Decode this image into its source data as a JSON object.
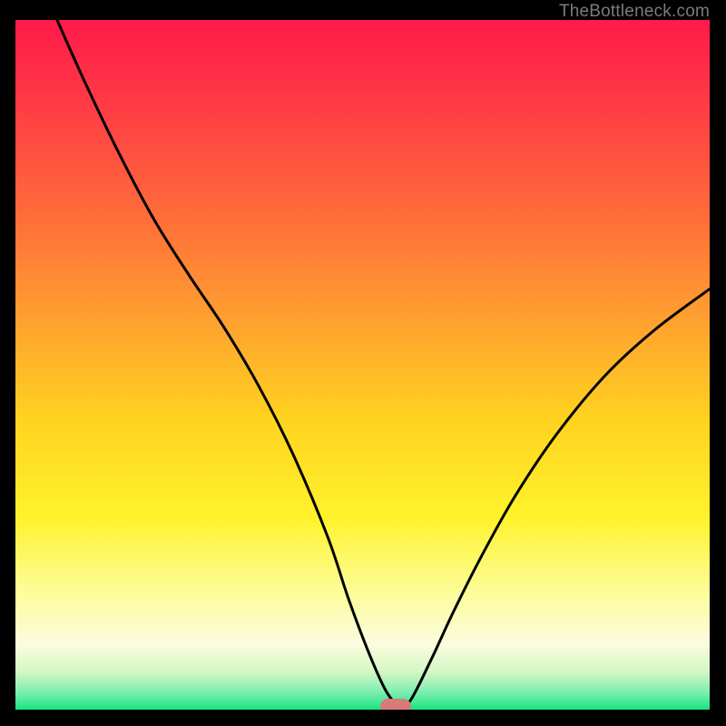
{
  "watermark": "TheBottleneck.com",
  "chart_data": {
    "type": "line",
    "title": "",
    "xlabel": "",
    "ylabel": "",
    "xlim": [
      0,
      100
    ],
    "ylim": [
      0,
      100
    ],
    "grid": false,
    "legend": false,
    "gradient_stops": [
      {
        "pos": 0.0,
        "color": "#ff1a4a"
      },
      {
        "pos": 0.12,
        "color": "#ff3a45"
      },
      {
        "pos": 0.28,
        "color": "#ff6b3a"
      },
      {
        "pos": 0.44,
        "color": "#ffa22f"
      },
      {
        "pos": 0.58,
        "color": "#ffd31f"
      },
      {
        "pos": 0.72,
        "color": "#fff22a"
      },
      {
        "pos": 0.83,
        "color": "#fdfd9a"
      },
      {
        "pos": 0.905,
        "color": "#fbfce0"
      },
      {
        "pos": 0.945,
        "color": "#d4f7c4"
      },
      {
        "pos": 0.975,
        "color": "#7ceeb0"
      },
      {
        "pos": 1.0,
        "color": "#18e47f"
      }
    ],
    "series": [
      {
        "name": "bottleneck-curve",
        "x": [
          6.0,
          10.0,
          15.0,
          20.0,
          25.0,
          30.0,
          35.0,
          40.0,
          45.0,
          48.0,
          51.0,
          53.5,
          55.5,
          57.0,
          60.0,
          63.0,
          67.0,
          72.0,
          78.0,
          85.0,
          92.0,
          100.0
        ],
        "y": [
          100.0,
          91.0,
          80.5,
          71.0,
          63.0,
          55.5,
          47.0,
          37.0,
          25.0,
          16.0,
          8.0,
          2.5,
          0.5,
          1.5,
          7.5,
          14.0,
          22.0,
          31.0,
          40.0,
          48.5,
          55.0,
          61.0
        ]
      }
    ],
    "optimum_marker": {
      "x_min": 52.5,
      "x_max": 57.0,
      "y": 0.5
    }
  }
}
